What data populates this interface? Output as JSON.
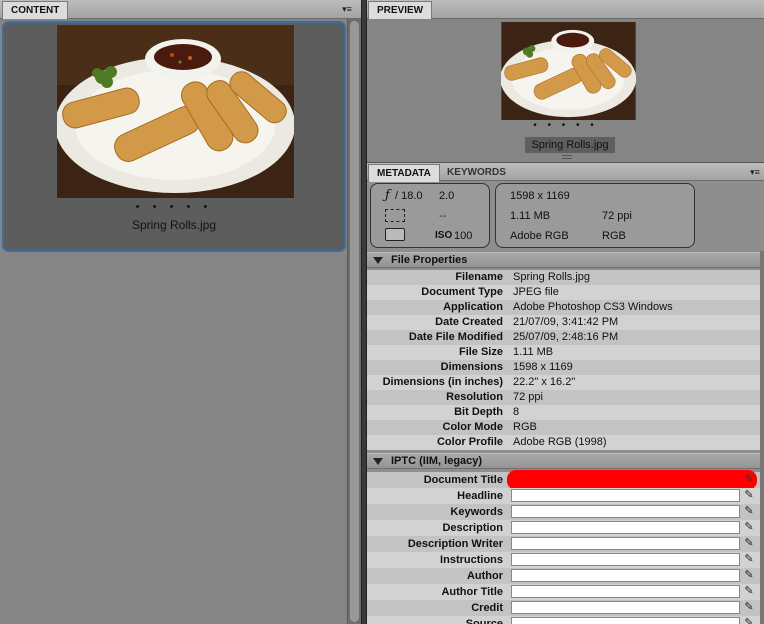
{
  "content_panel": {
    "tab_label": "CONTENT",
    "menu_icon": "panel-menu-icon",
    "thumbnail": {
      "rating": "• • • • •",
      "filename": "Spring Rolls.jpg"
    }
  },
  "preview_panel": {
    "tab_label": "PREVIEW",
    "rating": "• • • • •",
    "filename": "Spring Rolls.jpg"
  },
  "metadata_panel": {
    "tabs": [
      "METADATA",
      "KEYWORDS"
    ],
    "placard": {
      "f_symbol": "ƒ",
      "aperture": "/ 18.0",
      "shutter": "2.0",
      "metering": "--",
      "iso_label": "ISO",
      "iso": "100",
      "dimensions": "1598 x 1169",
      "file_size": "1.11 MB",
      "resolution": "72 ppi",
      "color_profile": "Adobe RGB",
      "color_mode": "RGB"
    },
    "file_properties": {
      "title": "File Properties",
      "rows": [
        {
          "label": "Filename",
          "value": "Spring Rolls.jpg"
        },
        {
          "label": "Document Type",
          "value": "JPEG file"
        },
        {
          "label": "Application",
          "value": "Adobe Photoshop CS3 Windows"
        },
        {
          "label": "Date Created",
          "value": "21/07/09, 3:41:42 PM"
        },
        {
          "label": "Date File Modified",
          "value": "25/07/09, 2:48:16 PM"
        },
        {
          "label": "File Size",
          "value": "1.11 MB"
        },
        {
          "label": "Dimensions",
          "value": "1598 x 1169"
        },
        {
          "label": "Dimensions (in inches)",
          "value": "22.2\" x 16.2\""
        },
        {
          "label": "Resolution",
          "value": "72 ppi"
        },
        {
          "label": "Bit Depth",
          "value": "8"
        },
        {
          "label": "Color Mode",
          "value": "RGB"
        },
        {
          "label": "Color Profile",
          "value": "Adobe RGB (1998)"
        }
      ]
    },
    "iptc": {
      "title": "IPTC (IIM, legacy)",
      "fields": [
        {
          "label": "Document Title",
          "value": ""
        },
        {
          "label": "Headline",
          "value": ""
        },
        {
          "label": "Keywords",
          "value": ""
        },
        {
          "label": "Description",
          "value": ""
        },
        {
          "label": "Description Writer",
          "value": ""
        },
        {
          "label": "Instructions",
          "value": ""
        },
        {
          "label": "Author",
          "value": ""
        },
        {
          "label": "Author Title",
          "value": ""
        },
        {
          "label": "Credit",
          "value": ""
        },
        {
          "label": "Source",
          "value": ""
        }
      ],
      "highlight_color": "#ff0000"
    }
  },
  "colors": {
    "selection_border": "#3d6c9e",
    "panel_bg": "#858585",
    "highlight": "#ff0000"
  }
}
